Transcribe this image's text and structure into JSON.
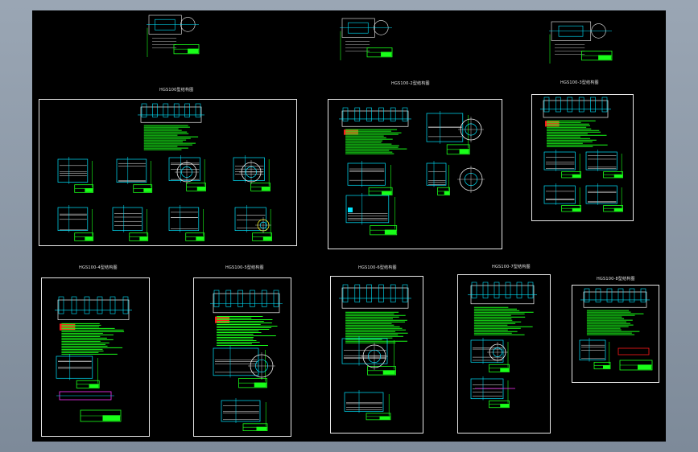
{
  "colors": {
    "background": "#000000",
    "frame": "#e8e8e8",
    "green": "#19ff19",
    "cyan": "#00e5ff",
    "white": "#f0f0f0",
    "red": "#ff1a1a",
    "magenta": "#ff33ff",
    "yellow": "#e8e81a"
  },
  "sheets": [
    {
      "id": "top-1",
      "title": ""
    },
    {
      "id": "top-2",
      "title": ""
    },
    {
      "id": "top-3",
      "title": ""
    },
    {
      "id": "sheet-a",
      "title": "HGS100型结构图"
    },
    {
      "id": "sheet-b",
      "title": "HGS100-2型结构图"
    },
    {
      "id": "sheet-c",
      "title": "HGS100-3型结构图"
    },
    {
      "id": "sheet-d",
      "title": "HGS100-4型结构图"
    },
    {
      "id": "sheet-e",
      "title": "HGS100-5型结构图"
    },
    {
      "id": "sheet-f",
      "title": "HGS100-6型结构图"
    },
    {
      "id": "sheet-g",
      "title": "HGS100-7型结构图"
    },
    {
      "id": "sheet-h",
      "title": "HGS100-8型结构图"
    }
  ]
}
